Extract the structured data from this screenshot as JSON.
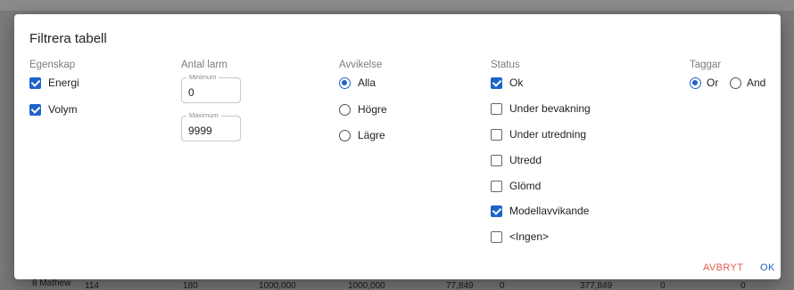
{
  "background_row": {
    "cells": [
      "8 Mathew",
      "114",
      "180",
      "1000,000",
      "1000,000",
      "77,849",
      "0",
      "377,849",
      "0",
      "0"
    ]
  },
  "dialog": {
    "title": "Filtrera tabell",
    "egenskap": {
      "label": "Egenskap",
      "options": [
        {
          "label": "Energi",
          "checked": true
        },
        {
          "label": "Volym",
          "checked": true
        }
      ]
    },
    "antal_larm": {
      "label": "Antal larm",
      "minimum": {
        "label": "Minimum",
        "value": "0"
      },
      "maximum": {
        "label": "Maximum",
        "value": "9999"
      }
    },
    "avvikelse": {
      "label": "Avvikelse",
      "options": [
        {
          "label": "Alla",
          "checked": true
        },
        {
          "label": "Högre",
          "checked": false
        },
        {
          "label": "Lägre",
          "checked": false
        }
      ]
    },
    "status": {
      "label": "Status",
      "options": [
        {
          "label": "Ok",
          "checked": true
        },
        {
          "label": "Under bevakning",
          "checked": false
        },
        {
          "label": "Under utredning",
          "checked": false
        },
        {
          "label": "Utredd",
          "checked": false
        },
        {
          "label": "Glömd",
          "checked": false
        },
        {
          "label": "Modellavvikande",
          "checked": true
        },
        {
          "label": "<Ingen>",
          "checked": false
        }
      ]
    },
    "taggar": {
      "label": "Taggar",
      "options": [
        {
          "label": "Or",
          "checked": true
        },
        {
          "label": "And",
          "checked": false
        }
      ]
    },
    "buttons": {
      "cancel": "AVBRYT",
      "ok": "OK"
    }
  },
  "colors": {
    "accent": "#1e63c9",
    "danger": "#e05a4e"
  }
}
